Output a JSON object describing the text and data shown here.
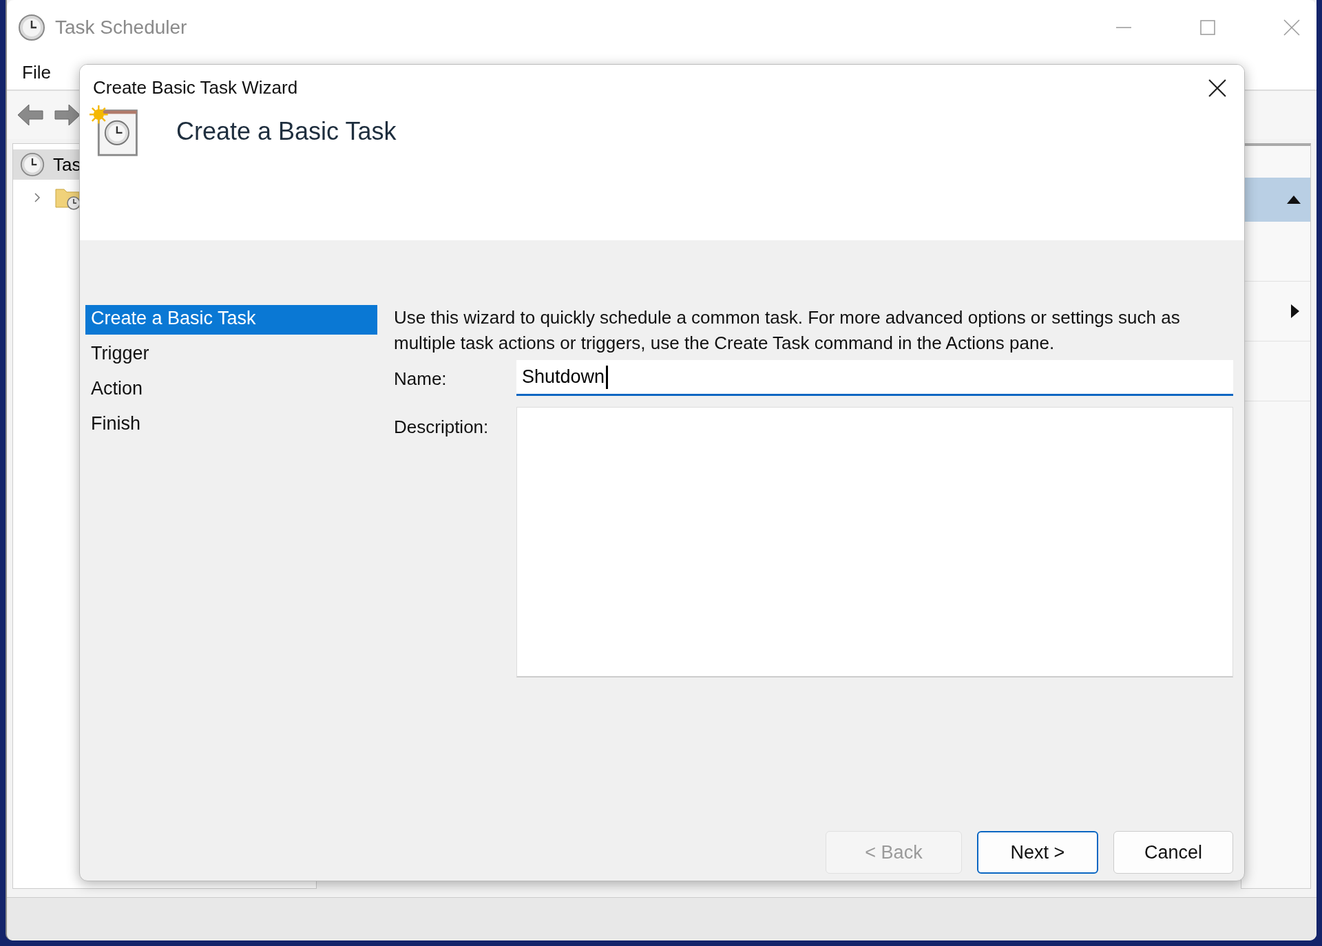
{
  "window": {
    "title": "Task Scheduler"
  },
  "menu": [
    "File"
  ],
  "tree": {
    "root": "Tas"
  },
  "dialog": {
    "title": "Create Basic Task Wizard",
    "heading": "Create a Basic Task",
    "steps": [
      {
        "label": "Create a Basic Task",
        "selected": true
      },
      {
        "label": "Trigger",
        "selected": false
      },
      {
        "label": "Action",
        "selected": false
      },
      {
        "label": "Finish",
        "selected": false
      }
    ],
    "intro": "Use this wizard to quickly schedule a common task.  For more advanced options or settings such as multiple task actions or triggers, use the Create Task command in the Actions pane.",
    "name": {
      "label": "Name:",
      "value": "Shutdown"
    },
    "description": {
      "label": "Description:"
    },
    "buttons": [
      {
        "label": "< Back",
        "disabled": true,
        "primary": false
      },
      {
        "label": "Next >",
        "disabled": false,
        "primary": true
      },
      {
        "label": "Cancel",
        "disabled": false,
        "primary": false
      }
    ]
  }
}
